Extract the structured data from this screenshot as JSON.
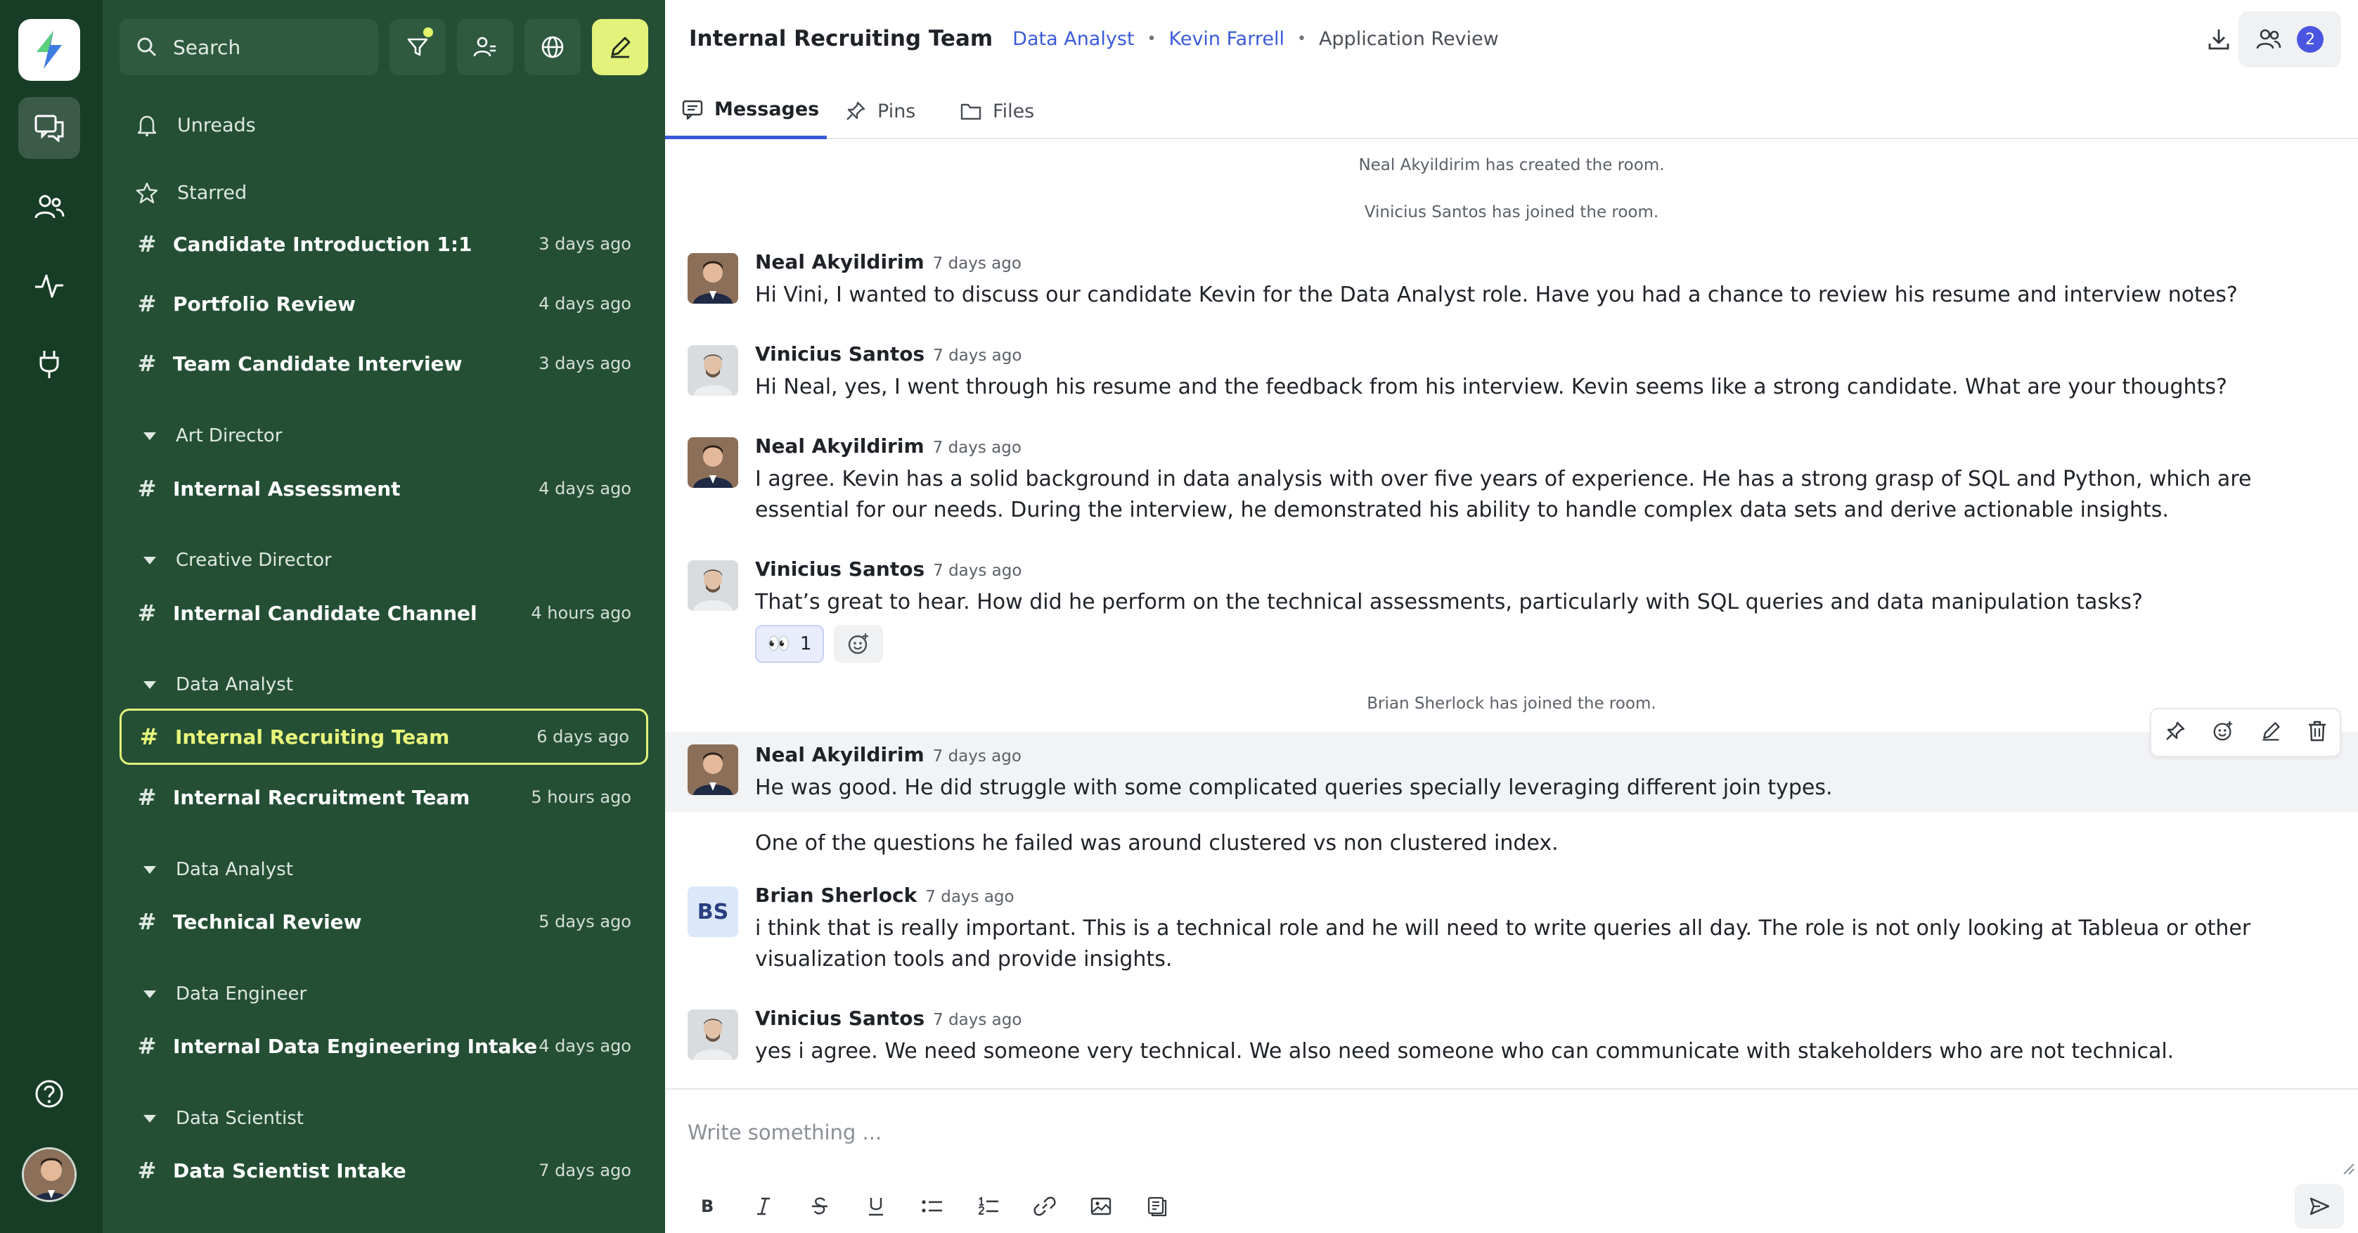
{
  "sidebar": {
    "search_placeholder": "Search",
    "unreads_label": "Unreads",
    "starred_label": "Starred",
    "starred": [
      {
        "name": "Candidate Introduction 1:1",
        "time": "3 days ago"
      },
      {
        "name": "Portfolio Review",
        "time": "4 days ago"
      },
      {
        "name": "Team Candidate Interview",
        "time": "3 days ago"
      }
    ],
    "groups": [
      {
        "label": "Art Director",
        "channels": [
          {
            "name": "Internal Assessment",
            "time": "4 days ago"
          }
        ]
      },
      {
        "label": "Creative Director",
        "channels": [
          {
            "name": "Internal Candidate Channel",
            "time": "4 hours ago"
          }
        ]
      },
      {
        "label": "Data Analyst",
        "channels": [
          {
            "name": "Internal Recruiting Team",
            "time": "6 days ago"
          },
          {
            "name": "Internal Recruitment Team",
            "time": "5 hours ago"
          }
        ]
      },
      {
        "label": "Data Analyst",
        "channels": [
          {
            "name": "Technical Review",
            "time": "5 days ago"
          }
        ]
      },
      {
        "label": "Data Engineer",
        "channels": [
          {
            "name": "Internal Data Engineering Intake",
            "time": "4 days ago"
          }
        ]
      },
      {
        "label": "Data Scientist",
        "channels": [
          {
            "name": "Data Scientist Intake",
            "time": "7 days ago"
          }
        ]
      }
    ]
  },
  "header": {
    "title": "Internal Recruiting Team",
    "crumb_1": "Data Analyst",
    "crumb_2": "Kevin Farrell",
    "crumb_3": "Application Review",
    "member_count": "2"
  },
  "tabs": [
    {
      "label": "Messages",
      "icon": "message-icon",
      "active": true
    },
    {
      "label": "Pins",
      "icon": "pin-icon"
    },
    {
      "label": "Files",
      "icon": "folder-icon"
    }
  ],
  "system_messages": [
    "Neal Akyildirim has created the room.",
    "Vinicius Santos has joined the room.",
    "Brian Sherlock has joined the room."
  ],
  "messages": [
    {
      "author": "Neal Akyildirim",
      "time": "7 days ago",
      "text": "Hi Vini, I wanted to discuss our candidate Kevin for the Data Analyst role. Have you had a chance to review his resume and interview notes?"
    },
    {
      "author": "Vinicius Santos",
      "time": "7 days ago",
      "text": "Hi Neal, yes, I went through his resume and the feedback from his interview. Kevin seems like a strong candidate. What are your thoughts?"
    },
    {
      "author": "Neal Akyildirim",
      "time": "7 days ago",
      "text": "I agree. Kevin has a solid background in data analysis with over five years of experience. He has a strong grasp of SQL and Python, which are essential for our needs. During the interview, he demonstrated his ability to handle complex data sets and derive actionable insights."
    },
    {
      "author": "Vinicius Santos",
      "time": "7 days ago",
      "text": "That’s great to hear. How did he perform on the technical assessments, particularly with SQL queries and data manipulation tasks?",
      "reaction_emoji": "👀",
      "reaction_count": "1"
    },
    {
      "author": "Neal Akyildirim",
      "time": "7 days ago",
      "text": "He was good. He did struggle with some complicated queries specially leveraging different join types."
    },
    {
      "text": "One of the questions he failed was around clustered vs non clustered index."
    },
    {
      "author": "Brian Sherlock",
      "initials": "BS",
      "time": "7 days ago",
      "text": "i think that is really important. This is a technical role and he will need to write queries all day. The role is not only looking at Tableua or other visualization tools and provide insights."
    },
    {
      "author": "Vinicius Santos",
      "time": "7 days ago",
      "text": "yes i agree. We need someone very technical. We also need someone who can communicate with stakeholders who are not technical."
    }
  ],
  "composer": {
    "placeholder": "Write something ..."
  },
  "colors": {
    "rail": "#183d27",
    "sidebar": "#244f35",
    "accent_lime": "#e2f27a",
    "link_blue": "#3a5bd9"
  }
}
